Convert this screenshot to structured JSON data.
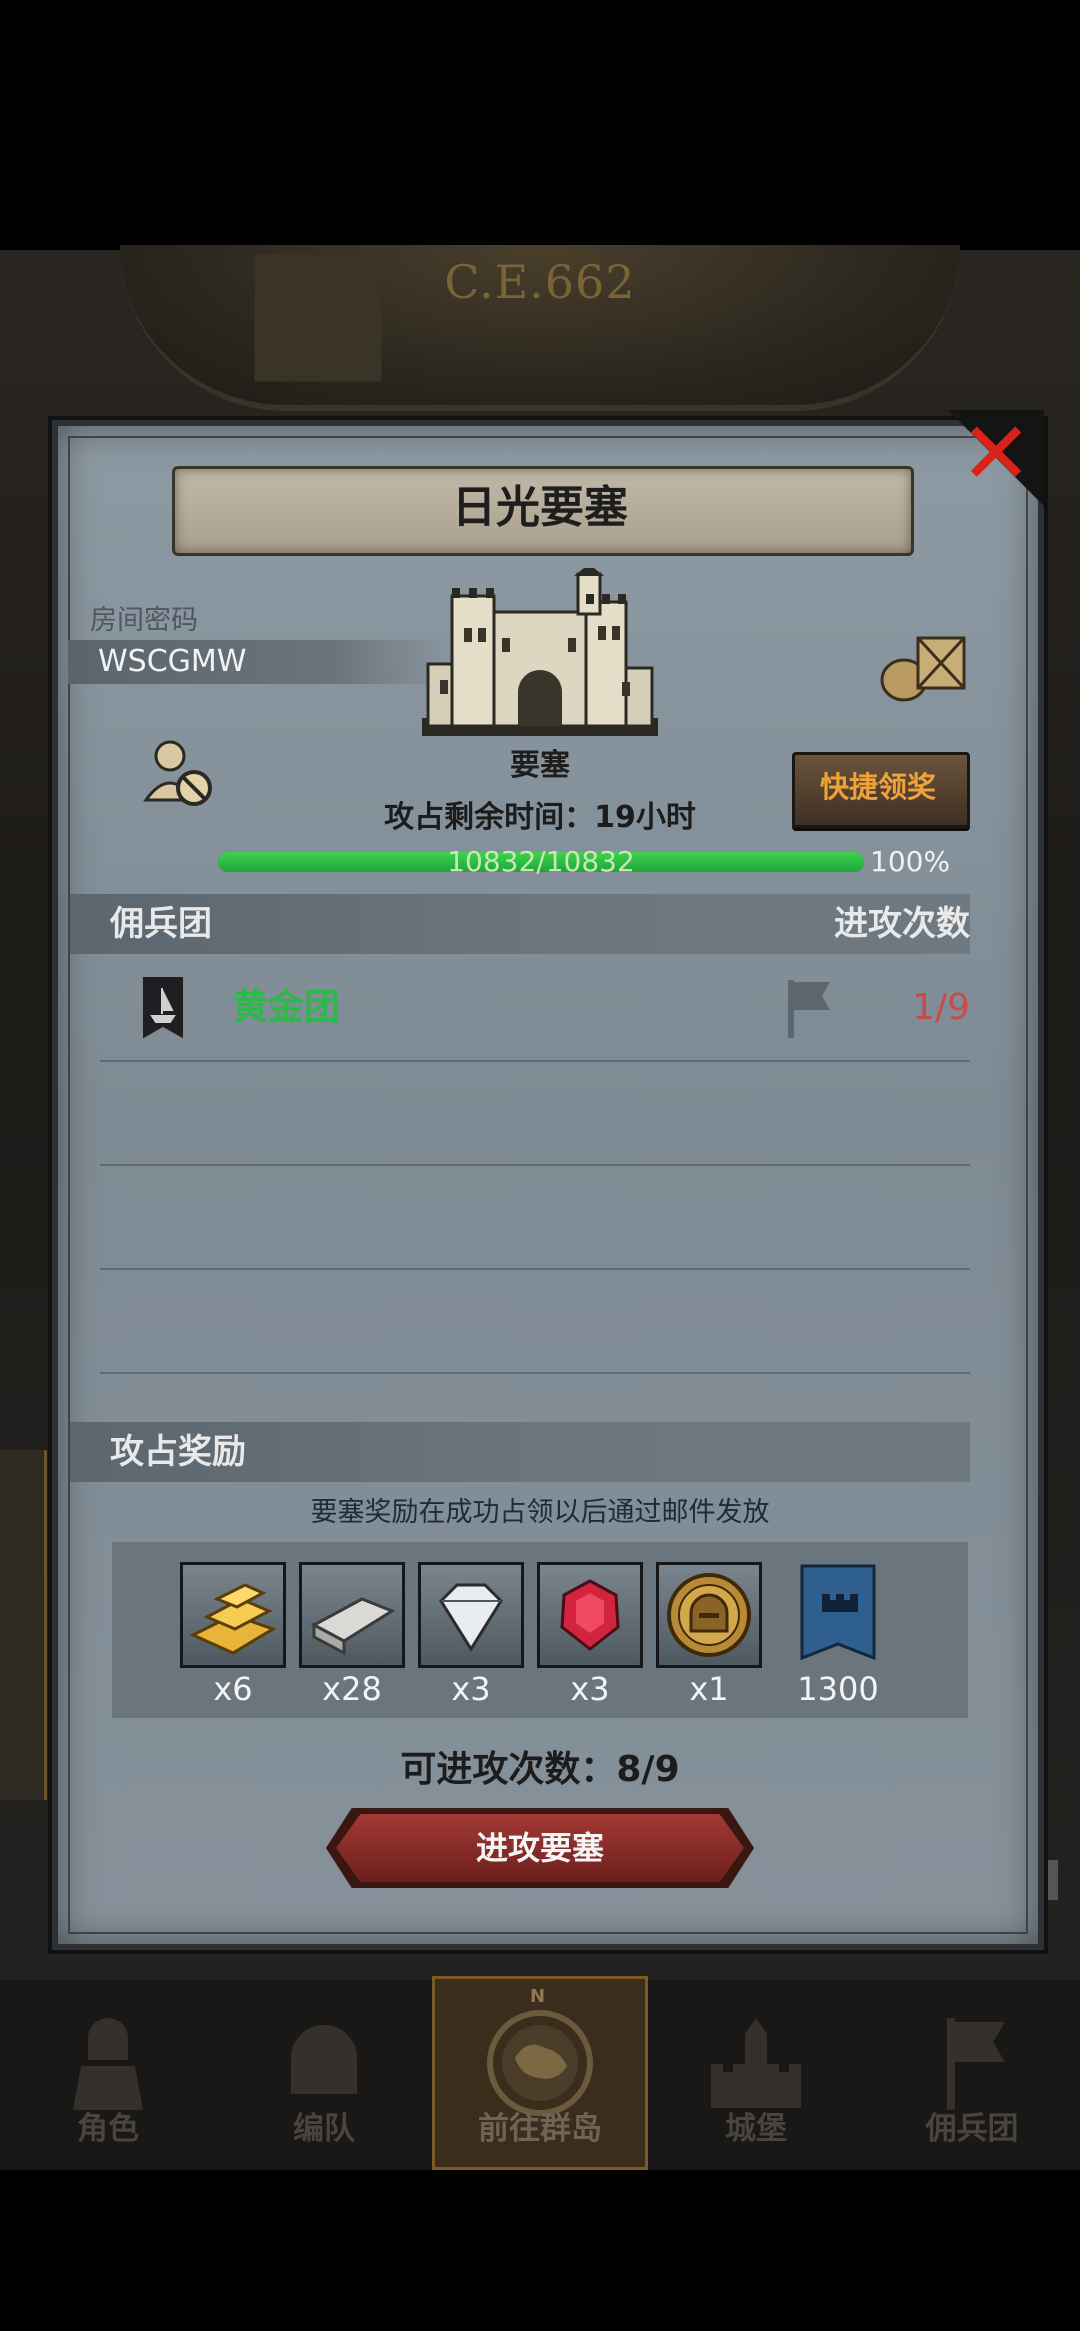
{
  "header": {
    "era_label": "C.E.662"
  },
  "dialog": {
    "title": "日光要塞",
    "room": {
      "label": "房间密码",
      "code": "WSCGMW"
    },
    "fortress_label": "要塞",
    "quick_claim_label": "快捷领奖",
    "time_left": "攻占剩余时间：19小时",
    "progress": {
      "text": "10832/10832",
      "percent_label": "100%",
      "fraction": 1.0
    },
    "mercenary_header": "佣兵团",
    "attack_count_header": "进攻次数",
    "mercenaries": [
      {
        "name": "黄金团",
        "attacks": "1/9"
      }
    ],
    "rewards_header": "攻占奖励",
    "rewards_note": "要塞奖励在成功占领以后通过邮件发放",
    "rewards": [
      {
        "icon": "gold-bar-icon",
        "qty": "x6"
      },
      {
        "icon": "silver-bar-icon",
        "qty": "x28"
      },
      {
        "icon": "diamond-icon",
        "qty": "x3"
      },
      {
        "icon": "ruby-icon",
        "qty": "x3"
      },
      {
        "icon": "helmet-medal-icon",
        "qty": "x1"
      },
      {
        "icon": "castle-banner-icon",
        "qty": "1300"
      }
    ],
    "attacks_left": "可进攻次数：8/9",
    "attack_button": "进攻要塞"
  },
  "nav": {
    "items": [
      {
        "label": "角色",
        "icon": "knight-icon"
      },
      {
        "label": "编队",
        "icon": "helmet-icon"
      },
      {
        "label": "前往群岛",
        "icon": "compass-map-icon"
      },
      {
        "label": "城堡",
        "icon": "castle-icon"
      },
      {
        "label": "佣兵团",
        "icon": "flag-icon"
      }
    ],
    "active_index": 2
  },
  "colors": {
    "accent_green": "#2db94a",
    "quick_claim_text": "#f0a23a",
    "attack_count_red": "#c84b4b",
    "close_red": "#d8221a",
    "attack_button_red": "#a33a35"
  }
}
